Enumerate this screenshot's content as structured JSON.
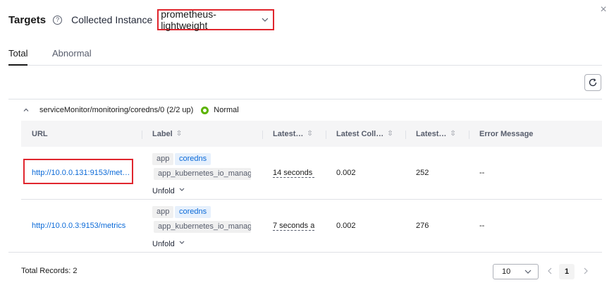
{
  "header": {
    "title": "Targets",
    "help_icon": "question-circle-icon",
    "collected_label": "Collected Instance",
    "instance_value": "prometheus-lightweight"
  },
  "tabs": [
    {
      "label": "Total",
      "active": true
    },
    {
      "label": "Abnormal",
      "active": false
    }
  ],
  "group": {
    "name": "serviceMonitor/monitoring/coredns/0 (2/2 up)",
    "status": "Normal",
    "status_color": "#5cb300"
  },
  "table": {
    "columns": [
      "URL",
      "Label",
      "Latest…",
      "Latest Coll…",
      "Latest…",
      "Error Message"
    ],
    "rows": [
      {
        "url": "http://10.0.0.131:9153/met…",
        "tags": [
          "app",
          "coredns",
          "app_kubernetes_io_manag"
        ],
        "unfold": "Unfold",
        "latest": "14 seconds",
        "collect": "0.002",
        "samples": "252",
        "error": "--"
      },
      {
        "url": "http://10.0.0.3:9153/metrics",
        "tags": [
          "app",
          "coredns",
          "app_kubernetes_io_manag"
        ],
        "unfold": "Unfold",
        "latest": "7 seconds a",
        "collect": "0.002",
        "samples": "276",
        "error": "--"
      }
    ]
  },
  "footer": {
    "total_records": "Total Records: 2",
    "page_size": "10",
    "current_page": "1"
  },
  "colors": {
    "accent": "#0b6ad8",
    "highlight": "#e0262e"
  }
}
